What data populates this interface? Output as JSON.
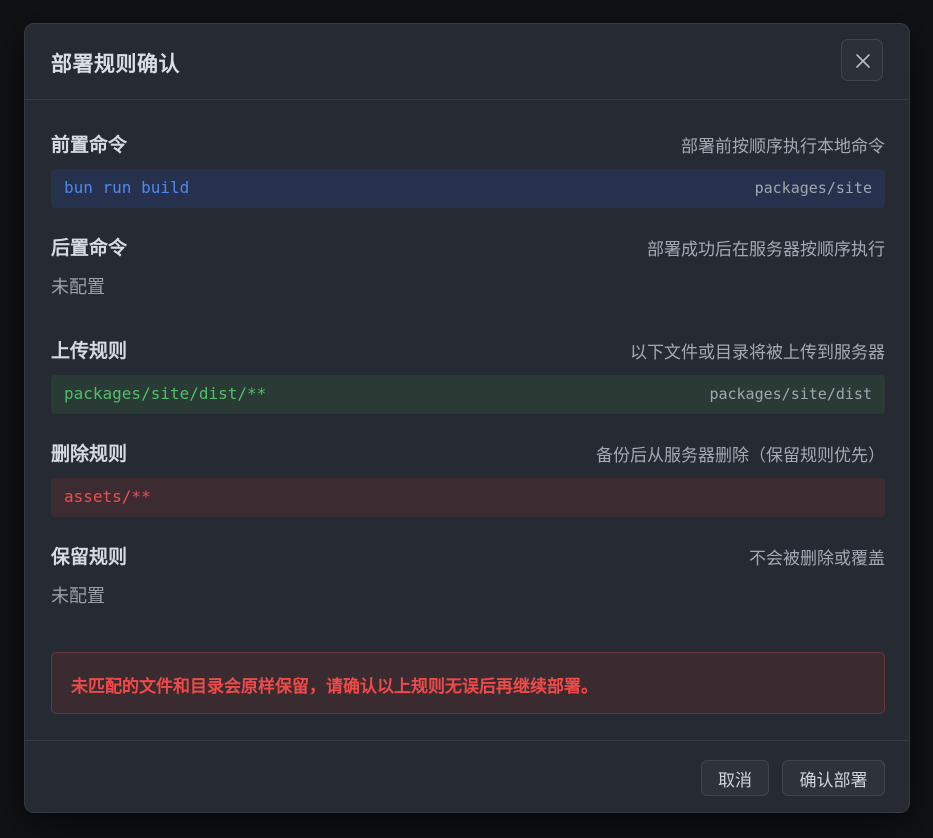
{
  "dialog": {
    "title": "部署规则确认",
    "close_icon": "close-icon"
  },
  "sections": {
    "pre": {
      "title": "前置命令",
      "desc": "部署前按顺序执行本地命令",
      "command": "bun run build",
      "dir": "packages/site"
    },
    "post": {
      "title": "后置命令",
      "desc": "部署成功后在服务器按顺序执行",
      "value": "未配置"
    },
    "upload": {
      "title": "上传规则",
      "desc": "以下文件或目录将被上传到服务器",
      "rule": "packages/site/dist/**",
      "dir": "packages/site/dist"
    },
    "delete": {
      "title": "删除规则",
      "desc": "备份后从服务器删除（保留规则优先）",
      "rule": "assets/**"
    },
    "keep": {
      "title": "保留规则",
      "desc": "不会被删除或覆盖",
      "value": "未配置"
    }
  },
  "warning": {
    "text": "未匹配的文件和目录会原样保留，请确认以上规则无误后再继续部署。"
  },
  "footer": {
    "cancel_label": "取消",
    "confirm_label": "确认部署"
  },
  "colors": {
    "pre_command": "#4f86f2",
    "upload_rule": "#4fbf6a",
    "delete_rule": "#ef4d4f",
    "warning_text": "#ef4a4a"
  }
}
